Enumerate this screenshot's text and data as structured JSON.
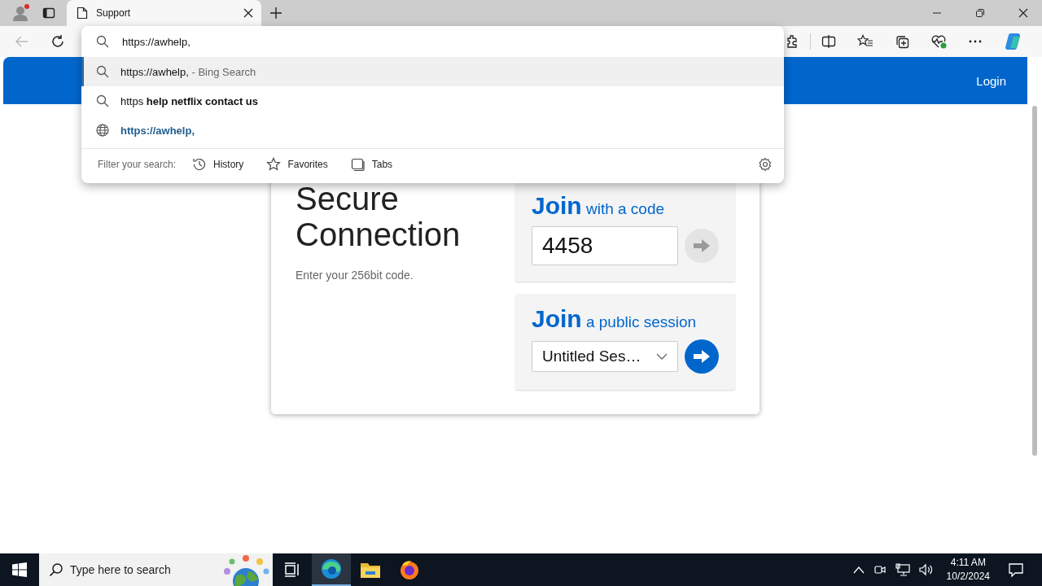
{
  "browser": {
    "tab": {
      "title": "Support",
      "selected": true
    },
    "address_input": "https://awhelp,",
    "suggestions": [
      {
        "kind": "search",
        "text": "https://awhelp,",
        "suffix": "- Bing Search",
        "selected": true
      },
      {
        "kind": "search",
        "text": "https **help netflix contact us**",
        "selected": false
      },
      {
        "kind": "site",
        "text": "https://awhelp,",
        "selected": false
      }
    ],
    "filter": {
      "label": "Filter your search:",
      "options": [
        {
          "kind": "history",
          "label": "History"
        },
        {
          "kind": "favorites",
          "label": "Favorites"
        },
        {
          "kind": "tabs",
          "label": "Tabs"
        }
      ]
    }
  },
  "page": {
    "header": {
      "login": "Login"
    },
    "heading": "Secure Connection",
    "subtitle": "Enter your 256bit code.",
    "panels": [
      {
        "kind": "code",
        "title": "Join",
        "subtitle": "with a code",
        "value": "4458",
        "disabled": true
      },
      {
        "kind": "select",
        "title": "Join",
        "subtitle": "a public session",
        "value": "Untitled Ses…",
        "disabled": false
      }
    ]
  },
  "taskbar": {
    "search_placeholder": "Type here to search",
    "apps": [
      {
        "kind": "taskview",
        "selected": false
      },
      {
        "kind": "edge",
        "selected": true
      },
      {
        "kind": "explorer",
        "selected": false
      },
      {
        "kind": "firefox",
        "selected": false
      }
    ],
    "time": "4:11 AM",
    "date": "10/2/2024"
  }
}
